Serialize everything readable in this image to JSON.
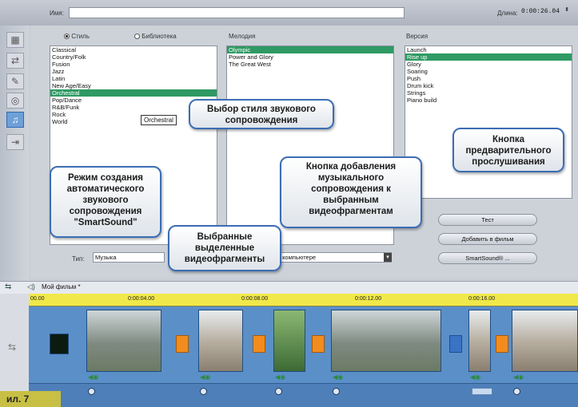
{
  "header": {
    "name_label": "Имя:",
    "length_label": "Длина:",
    "length_value": "0:00:26.04",
    "spin": "⬍"
  },
  "tools": [
    {
      "icon": "video-edit-icon",
      "glyph": "▦"
    },
    {
      "icon": "transition-icon",
      "glyph": "⇄"
    },
    {
      "icon": "title-icon",
      "glyph": "✎"
    },
    {
      "icon": "disc-icon",
      "glyph": "◎"
    },
    {
      "icon": "music-icon",
      "glyph": "♫"
    },
    {
      "icon": "export-icon",
      "glyph": "⇥"
    }
  ],
  "style": {
    "radio_style": "Стиль",
    "radio_library": "Библиотека",
    "items": [
      "Classical",
      "Country/Folk",
      "Fusion",
      "Jazz",
      "Latin",
      "New Age/Easy",
      "Orchestral",
      "Pop/Dance",
      "R&B/Funk",
      "Rock",
      "World"
    ],
    "selected_index": 6,
    "tooltip": "Orchestral"
  },
  "melody": {
    "header": "Мелодия",
    "items": [
      "Olympic",
      "Power and Glory",
      "The Great West"
    ],
    "selected_index": 0
  },
  "version": {
    "header": "Версия",
    "items": [
      "Launch",
      "Rise up",
      "Glory",
      "Soaring",
      "Push",
      "Drum kick",
      "Strings",
      "Piano build"
    ],
    "selected_index": 1
  },
  "buttons": {
    "test": "Тест",
    "add_to_film": "Добавить в фильм",
    "smartsound": "SmartSound® ..."
  },
  "type_row": {
    "label": "Тип:",
    "value": "Музыка",
    "source_value": "в компьютере"
  },
  "callouts": {
    "style_choice": "Выбор стиля звукового сопровождения",
    "preview_button": "Кнопка предварительного прослушивания",
    "add_button": "Кнопка добавления музыкального сопровождения к выбранным видеофрагментам",
    "smartsound_mode": "Режим создания автоматического звукового сопровождения \"SmartSound\"",
    "selected_clips": "Выбранные выделенные видеофрагменты"
  },
  "timeline": {
    "title": "Мой фильм *",
    "ticks": [
      "00.00",
      "0:00:04.00",
      "0:00:08.00",
      "0:00:12.00",
      "0:00:16.00"
    ]
  },
  "figure_label": "ил. 7"
}
